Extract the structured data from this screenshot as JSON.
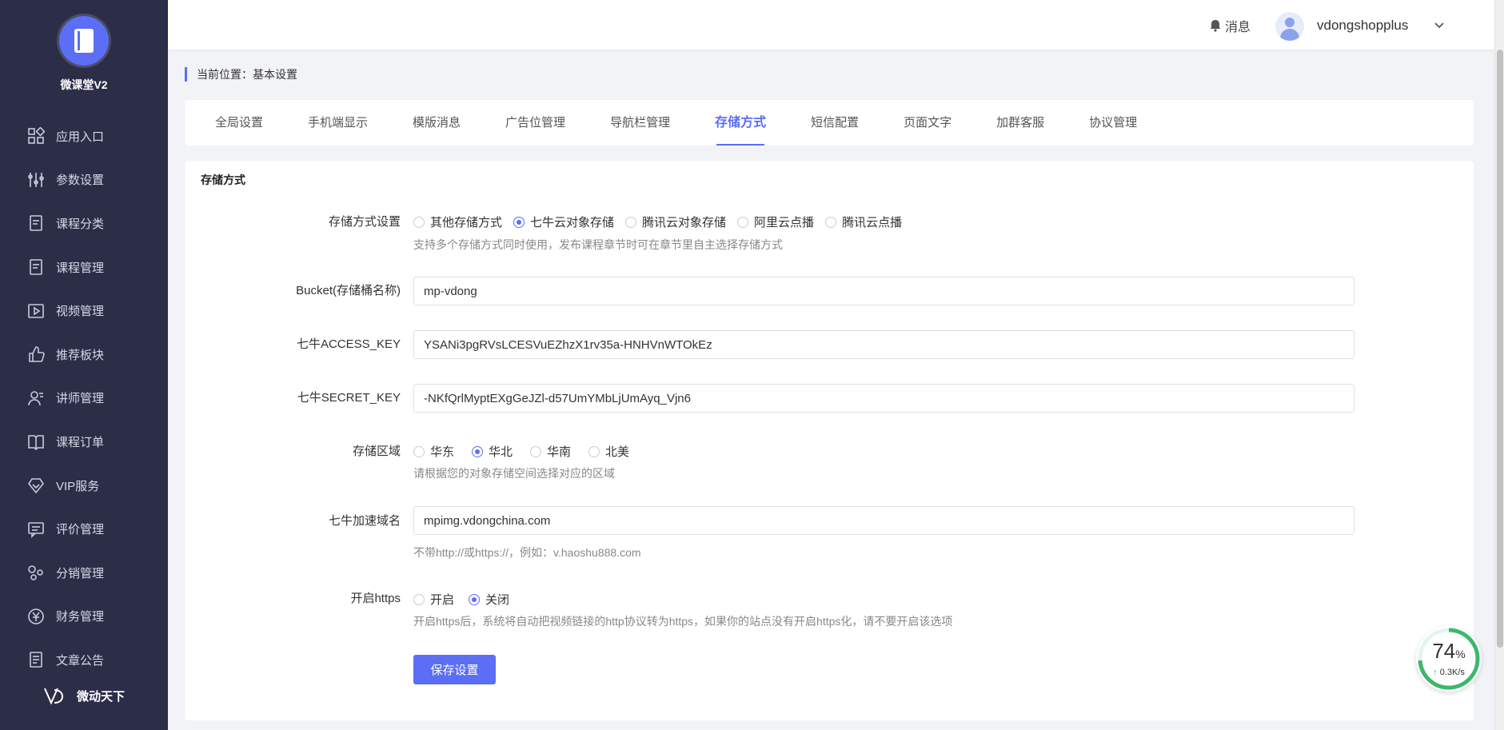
{
  "brand": {
    "name": "微课堂V2"
  },
  "sidebar": {
    "items": [
      {
        "label": "应用入口",
        "icon": "grid-icon"
      },
      {
        "label": "参数设置",
        "icon": "sliders-icon"
      },
      {
        "label": "课程分类",
        "icon": "document-icon"
      },
      {
        "label": "课程管理",
        "icon": "document-icon"
      },
      {
        "label": "视频管理",
        "icon": "play-icon"
      },
      {
        "label": "推荐板块",
        "icon": "thumbs-up-icon"
      },
      {
        "label": "讲师管理",
        "icon": "user-icon"
      },
      {
        "label": "课程订单",
        "icon": "book-icon"
      },
      {
        "label": "VIP服务",
        "icon": "diamond-icon"
      },
      {
        "label": "评价管理",
        "icon": "comment-icon"
      },
      {
        "label": "分销管理",
        "icon": "share-icon"
      },
      {
        "label": "财务管理",
        "icon": "yen-icon"
      },
      {
        "label": "文章公告",
        "icon": "article-icon"
      }
    ],
    "footer": "微动天下"
  },
  "header": {
    "messages": "消息",
    "username": "vdongshopplus"
  },
  "breadcrumb": "当前位置：基本设置",
  "tabs": [
    {
      "label": "全局设置",
      "active": false
    },
    {
      "label": "手机端显示",
      "active": false
    },
    {
      "label": "模版消息",
      "active": false
    },
    {
      "label": "广告位管理",
      "active": false
    },
    {
      "label": "导航栏管理",
      "active": false
    },
    {
      "label": "存储方式",
      "active": true
    },
    {
      "label": "短信配置",
      "active": false
    },
    {
      "label": "页面文字",
      "active": false
    },
    {
      "label": "加群客服",
      "active": false
    },
    {
      "label": "协议管理",
      "active": false
    }
  ],
  "form": {
    "title": "存储方式",
    "storage": {
      "label": "存储方式设置",
      "options": [
        "其他存储方式",
        "七牛云对象存储",
        "腾讯云对象存储",
        "阿里云点播",
        "腾讯云点播"
      ],
      "selected": "七牛云对象存储",
      "hint": "支持多个存储方式同时使用，发布课程章节时可在章节里自主选择存储方式"
    },
    "bucket": {
      "label": "Bucket(存储桶名称)",
      "value": "mp-vdong"
    },
    "access_key": {
      "label": "七牛ACCESS_KEY",
      "value": "YSANi3pgRVsLCESVuEZhzX1rv35a-HNHVnWTOkEz"
    },
    "secret_key": {
      "label": "七牛SECRET_KEY",
      "value": "-NKfQrlMyptEXgGeJZl-d57UmYMbLjUmAyq_Vjn6"
    },
    "region": {
      "label": "存储区域",
      "options": [
        "华东",
        "华北",
        "华南",
        "北美"
      ],
      "selected": "华北",
      "hint": "请根据您的对象存储空间选择对应的区域"
    },
    "domain": {
      "label": "七牛加速域名",
      "value": "mpimg.vdongchina.com",
      "hint": "不带http://或https://，例如：v.haoshu888.com"
    },
    "https": {
      "label": "开启https",
      "options": [
        "开启",
        "关闭"
      ],
      "selected": "关闭",
      "hint": "开启https后，系统将自动把视频链接的http协议转为https，如果你的站点没有开启https化，请不要开启该选项"
    },
    "save_label": "保存设置"
  },
  "speed_widget": {
    "percent": "74",
    "percent_unit": "%",
    "rate": "0.3K/s",
    "level": 0.74
  },
  "colors": {
    "accent": "#5b6ef5",
    "sidebar_bg": "#2c2e48",
    "ring": "#3cb86b"
  }
}
